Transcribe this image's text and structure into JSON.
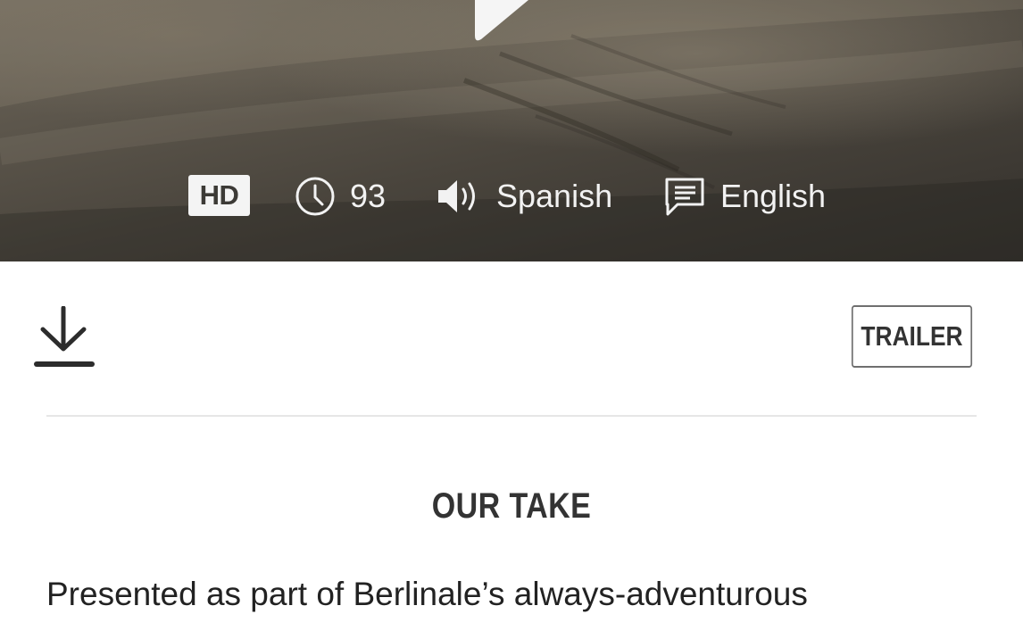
{
  "hero": {
    "hd_label": "HD",
    "duration": "93",
    "audio_language": "Spanish",
    "subtitle_language": "English"
  },
  "actions": {
    "trailer_label": "TRAILER"
  },
  "section": {
    "title": "OUR TAKE",
    "body": "Presented as part of Berlinale’s always-adventurous"
  },
  "icons": {
    "play": "play-icon",
    "clock": "clock-icon",
    "audio": "speaker-icon",
    "subtitles": "subtitles-icon",
    "download": "download-icon"
  },
  "colors": {
    "hero_overlay": "#4a453d",
    "meta_text": "#f2f2f2",
    "button_border": "#6f6f6f",
    "text_dark": "#333333"
  }
}
